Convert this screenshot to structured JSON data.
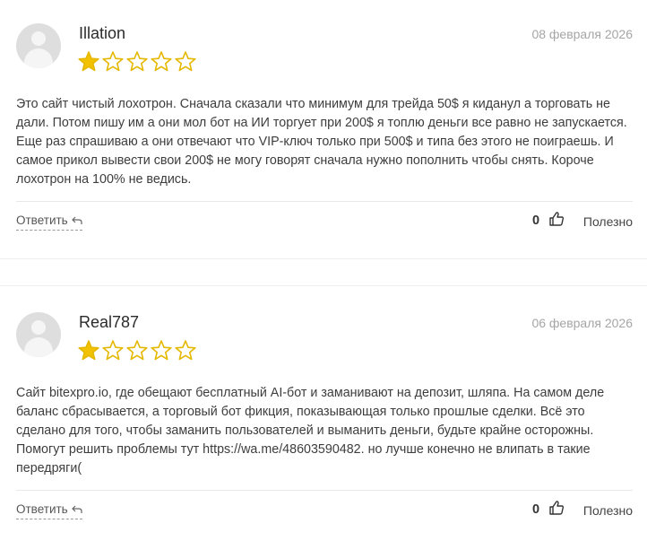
{
  "reviews": [
    {
      "author": "Illation",
      "date": "08 февраля 2026",
      "rating": 1,
      "rating_max": 5,
      "text": "Это сайт чистый лохотрон. Сначала сказали что минимум для трейда 50$ я киданул а торговать не дали. Потом пишу им а они мол бот на ИИ торгует при 200$ я топлю деньги все равно не запускается. Еще раз спрашиваю а они отвечают что VIP-ключ только при 500$ и типа без этого не поиграешь. И самое прикол вывести свои 200$ не могу говорят сначала нужно пополнить чтобы снять. Короче лохотрон на 100% не ведись.",
      "reply_label": "Ответить",
      "likes": "0",
      "useful_label": "Полезно"
    },
    {
      "author": "Real787",
      "date": "06 февраля 2026",
      "rating": 1,
      "rating_max": 5,
      "text_before_link": "Сайт bitexpro.io, где обещают бесплатный AI-бот и заманивают на депозит, шляпа. На самом деле баланс сбрасывается, а торговый бот фикция, показывающая только прошлые сделки. Всё это сделано для того, чтобы заманить пользователей и выманить деньги, будьте крайне осторожны. Помогут решить проблемы тут ",
      "link_text": "https://wa.me/48603590482",
      "text_after_link": ". но лучше конечно не влипать в такие передряги(",
      "reply_label": "Ответить",
      "likes": "0",
      "useful_label": "Полезно"
    }
  ],
  "colors": {
    "star_filled": "#f2c200",
    "star_empty": "#e5b800"
  }
}
